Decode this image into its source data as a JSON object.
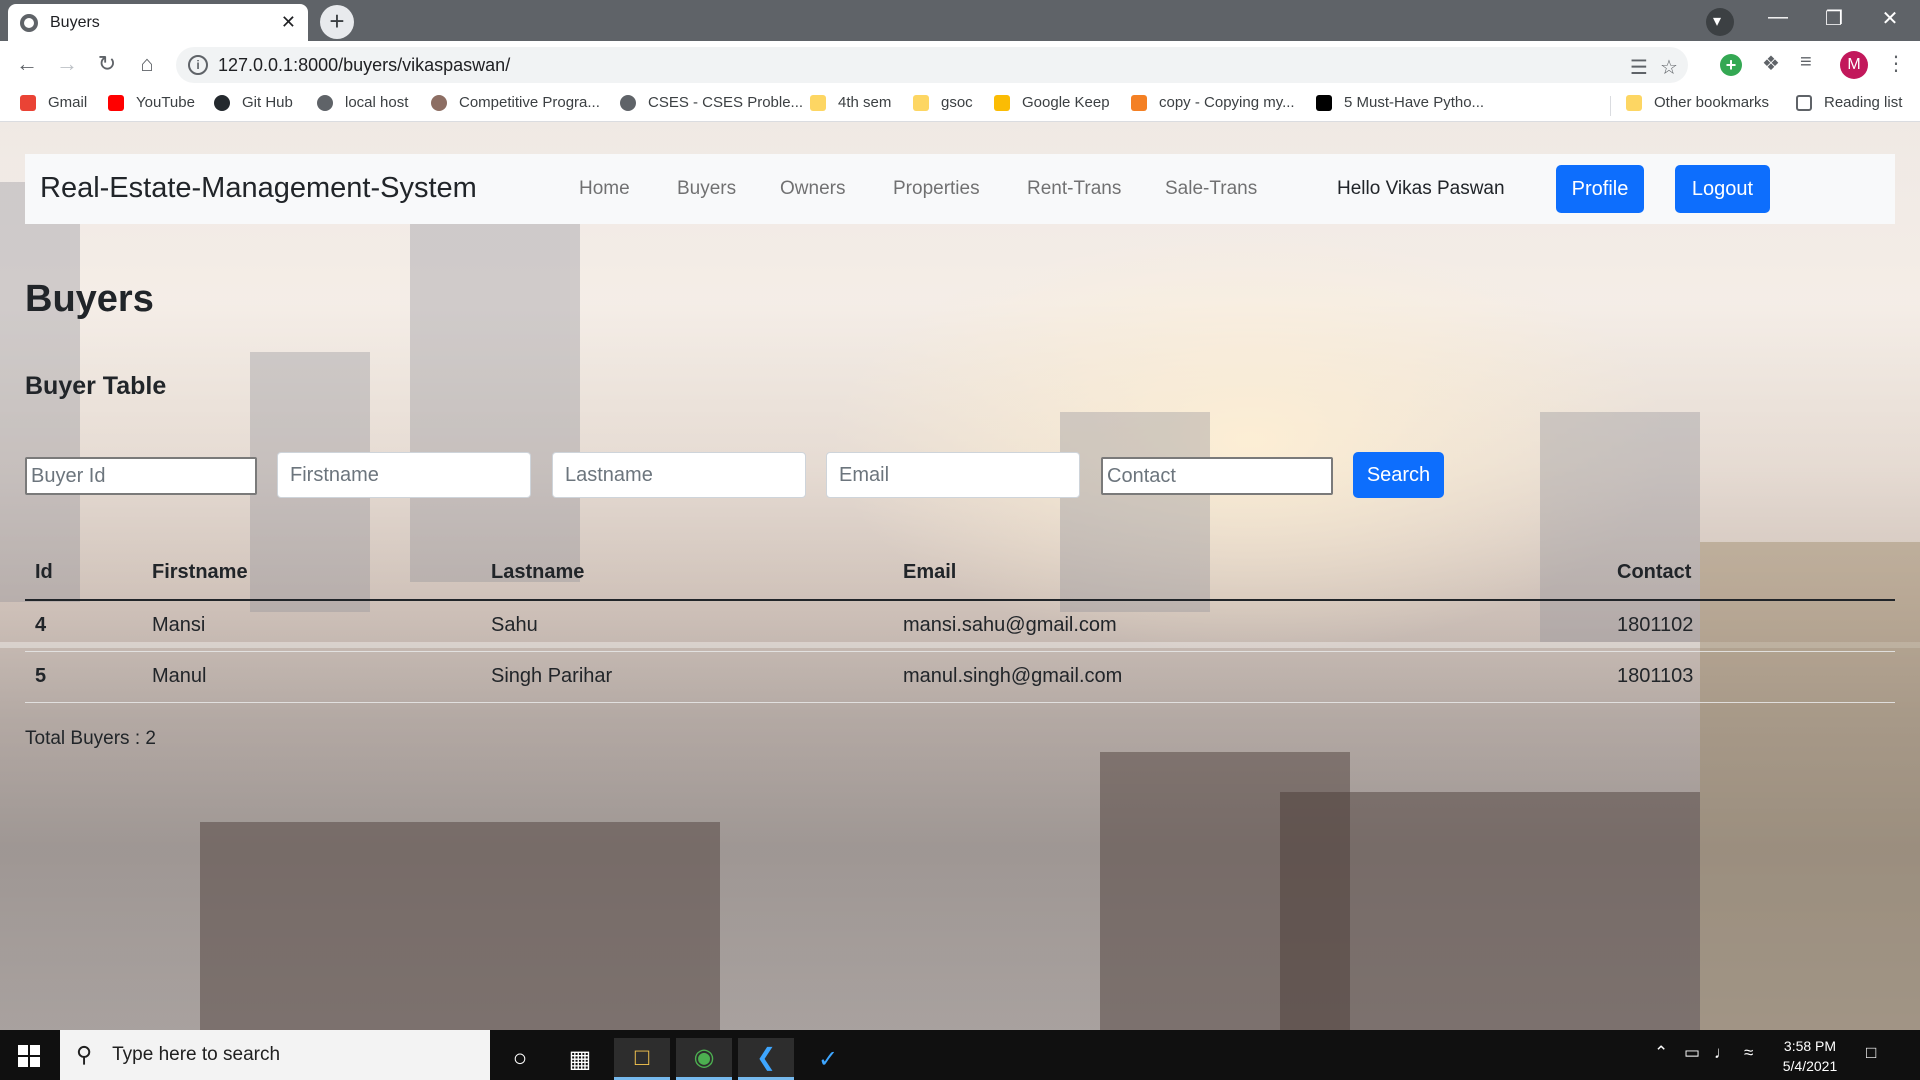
{
  "browser": {
    "tab_title": "Buyers",
    "url": "127.0.0.1:8000/buyers/vikaspaswan/",
    "profile_initial": "M",
    "bookmarks": [
      {
        "label": "Gmail",
        "icon": "gmail-icon",
        "color": "#ea4335"
      },
      {
        "label": "YouTube",
        "icon": "youtube-icon",
        "color": "#ff0000"
      },
      {
        "label": "Git Hub",
        "icon": "github-icon",
        "color": "#24292e"
      },
      {
        "label": "local host",
        "icon": "globe-icon",
        "color": "#5f6368"
      },
      {
        "label": "Competitive Progra...",
        "icon": "site-icon",
        "color": "#8d6e63"
      },
      {
        "label": "CSES - CSES Proble...",
        "icon": "globe-icon",
        "color": "#5f6368"
      },
      {
        "label": "4th sem",
        "icon": "folder-icon",
        "color": "#fdd663"
      },
      {
        "label": "gsoc",
        "icon": "folder-icon",
        "color": "#fdd663"
      },
      {
        "label": "Google Keep",
        "icon": "keep-icon",
        "color": "#fbbc04"
      },
      {
        "label": "copy - Copying my...",
        "icon": "stackoverflow-icon",
        "color": "#f48024"
      },
      {
        "label": "5 Must-Have Pytho...",
        "icon": "medium-icon",
        "color": "#000000"
      }
    ],
    "other_bookmarks": "Other bookmarks",
    "reading_list": "Reading list"
  },
  "navbar": {
    "brand": "Real-Estate-Management-System",
    "links": [
      "Home",
      "Buyers",
      "Owners",
      "Properties",
      "Rent-Trans",
      "Sale-Trans"
    ],
    "greeting": "Hello Vikas Paswan",
    "profile_button": "Profile",
    "logout_button": "Logout"
  },
  "page": {
    "title": "Buyers",
    "subtitle": "Buyer Table"
  },
  "search_form": {
    "buyer_id_placeholder": "Buyer Id",
    "firstname_placeholder": "Firstname",
    "lastname_placeholder": "Lastname",
    "email_placeholder": "Email",
    "contact_placeholder": "Contact",
    "search_button": "Search"
  },
  "table": {
    "headers": [
      "Id",
      "Firstname",
      "Lastname",
      "Email",
      "Contact"
    ],
    "rows": [
      {
        "id": "4",
        "firstname": "Mansi",
        "lastname": "Sahu",
        "email": "mansi.sahu@gmail.com",
        "contact": "1801102"
      },
      {
        "id": "5",
        "firstname": "Manul",
        "lastname": "Singh Parihar",
        "email": "manul.singh@gmail.com",
        "contact": "1801103"
      }
    ]
  },
  "total_text": "Total Buyers : 2",
  "taskbar": {
    "search_placeholder": "Type here to search",
    "time": "3:58 PM",
    "date": "5/4/2021"
  },
  "colors": {
    "primary": "#0d6efd",
    "navbar_bg": "#f8f9fa"
  }
}
